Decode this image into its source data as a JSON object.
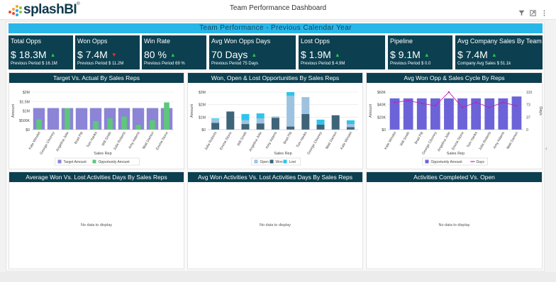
{
  "app": {
    "logo_text": "splashBI",
    "logo_mark": "®",
    "title": "Team Performance Dashboard",
    "icons": [
      "filter-icon",
      "expand-icon",
      "more-icon"
    ]
  },
  "banner": "Team Performance - Previous Calendar Year",
  "colors": {
    "card": "#0c3f4f",
    "banner": "#29b6e8",
    "up": "#23c552",
    "down": "#e5332a",
    "purple": "#6c63d9",
    "green": "#5ec77a",
    "open": "#9dc3e0",
    "won": "#3e6478",
    "lost": "#2fc3ec",
    "days": "#c020b0"
  },
  "kpis": [
    {
      "title": "Total Opps",
      "value": "$ 18.3M",
      "trend": "up",
      "prev": "Previous Period $ 16.1M"
    },
    {
      "title": "Won Opps",
      "value": "$ 7.4M",
      "trend": "down",
      "prev": "Previous Period $ 11.2M"
    },
    {
      "title": "Win Rate",
      "value": "80 %",
      "trend": "up",
      "prev": "Previous Period 69 %"
    },
    {
      "title": "Avg Won Opps Days",
      "value": "70 Days",
      "trend": "up",
      "prev": "Previous Period 75 Days"
    },
    {
      "title": "Lost Opps",
      "value": "$ 1.9M",
      "trend": "up",
      "prev": "Previous Period $ 4.9M"
    },
    {
      "title": "Pipeline",
      "value": "$ 9.1M",
      "trend": "up",
      "prev": "Previous Period $ 0.0"
    },
    {
      "title": "Avg Company Sales By Team",
      "value": "$ 7.4M",
      "trend": "up",
      "prev": "Company Avg Sales $ 51.1k"
    }
  ],
  "panels": {
    "target_vs_actual": {
      "title": "Target Vs. Actual By Sales Reps"
    },
    "won_open_lost": {
      "title": "Won, Open & Lost Opportunities By Sales Reps"
    },
    "avg_won_cycle": {
      "title": "Avg Won Opp & Sales Cycle By Reps"
    },
    "avg_activity_days": {
      "title": "Average Won Vs. Lost Activities Days By Sales Reps",
      "empty": "No data to display"
    },
    "avg_won_lost_activities": {
      "title": "Avg Won Activities Vs. Lost Activities Days By Sales Reps",
      "empty": "No data to display"
    },
    "activities_completed": {
      "title": "Activities Completed Vs. Open",
      "empty": "No data to display"
    }
  },
  "chart_data": [
    {
      "id": "target_vs_actual",
      "type": "bar",
      "title": "Target Vs. Actual By Sales Reps",
      "xlabel": "Sales Rep",
      "ylabel": "Amount",
      "yticks": [
        "$0",
        "$500K",
        "$1M",
        "$1.5M",
        "$2M"
      ],
      "ylim": [
        0,
        2000000
      ],
      "categories": [
        "Kate Winslet",
        "George Clooney",
        "Angelina Jolie",
        "Brad Pitt",
        "Tom Hanks",
        "Will Smith",
        "Julia Roberts",
        "Amy Adams",
        "Matt Damon",
        "Emma Stone"
      ],
      "series": [
        {
          "name": "Target Amount",
          "color": "#8c84d6",
          "values": [
            1150000,
            1150000,
            1150000,
            1150000,
            1150000,
            1150000,
            1150000,
            1150000,
            1150000,
            1150000
          ]
        },
        {
          "name": "Opportunity Amount",
          "color": "#5ec77a",
          "values": [
            550000,
            0,
            1150000,
            0,
            450000,
            600000,
            700000,
            250000,
            500000,
            1450000
          ]
        }
      ],
      "legend": "bottom"
    },
    {
      "id": "won_open_lost",
      "type": "bar",
      "stacked": true,
      "title": "Won, Open & Lost Opportunities By Sales Reps",
      "xlabel": "Sales Rep",
      "ylabel": "Amount",
      "yticks": [
        "$0",
        "$1M",
        "$2M",
        "$3M"
      ],
      "ylim": [
        0,
        3000000
      ],
      "categories": [
        "Julia Roberts",
        "Emma Stone",
        "Will Smith",
        "Angelina Jolie",
        "Amy Adams",
        "Brad Pitt",
        "Tom Hanks",
        "George Clooney",
        "Matt Damon",
        "Kate Winslet"
      ],
      "series": [
        {
          "name": "Open",
          "color": "#9dc3e0",
          "values": [
            300000,
            0,
            300000,
            400000,
            100000,
            2450000,
            1350000,
            0,
            0,
            250000
          ]
        },
        {
          "name": "Won",
          "color": "#3e6478",
          "values": [
            550000,
            1450000,
            450000,
            500000,
            950000,
            250000,
            1250000,
            400000,
            1150000,
            200000
          ]
        },
        {
          "name": "Lost",
          "color": "#2fc3ec",
          "values": [
            50000,
            0,
            500000,
            400000,
            0,
            300000,
            0,
            400000,
            0,
            300000
          ]
        }
      ],
      "legend": "bottom"
    },
    {
      "id": "avg_won_cycle",
      "type": "bar",
      "title": "Avg Won Opp & Sales Cycle By Reps",
      "xlabel": "Sales Rep",
      "ylabel": "Amount",
      "y2label": "Days",
      "yticks": [
        "$0",
        "$20K",
        "$40K",
        "$60K"
      ],
      "ylim": [
        0,
        60000
      ],
      "y2ticks": [
        "0",
        "37",
        "73",
        "110"
      ],
      "y2lim": [
        0,
        110
      ],
      "categories": [
        "Kate Winslet",
        "Will Smith",
        "Brad Pitt",
        "George Clooney",
        "Angelina Jolie",
        "Emma Stone",
        "Tom Hanks",
        "Julia Roberts",
        "Amy Adams",
        "Matt Damon"
      ],
      "series": [
        {
          "name": "Opportunity Amount",
          "color": "#6c63d9",
          "values": [
            50000,
            50000,
            50000,
            50000,
            50000,
            50000,
            50000,
            50000,
            50000,
            53000
          ]
        },
        {
          "name": "Days",
          "color": "#c020b0",
          "type": "line",
          "axis": "right",
          "values": [
            80,
            85,
            77,
            70,
            110,
            65,
            80,
            65,
            80,
            70
          ]
        }
      ],
      "legend": "bottom"
    }
  ]
}
